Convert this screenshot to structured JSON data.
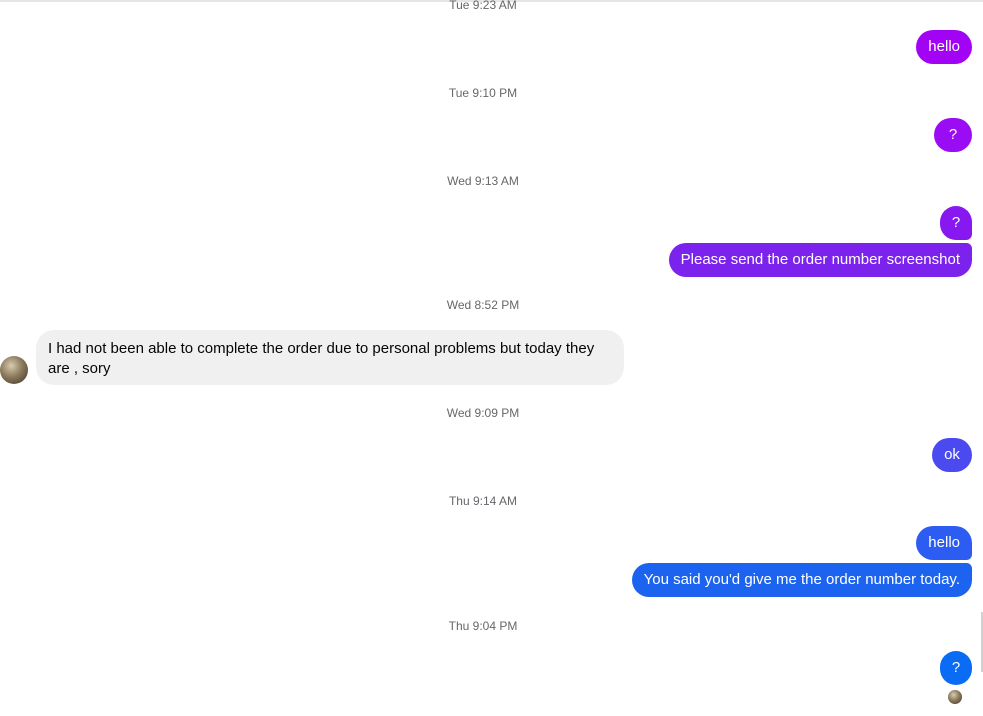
{
  "timestamps": [
    "Tue 9:23 AM",
    "Tue 9:10 PM",
    "Wed 9:13 AM",
    "Wed 8:52 PM",
    "Wed 9:09 PM",
    "Thu 9:14 AM",
    "Thu 9:04 PM"
  ],
  "messages": [
    {
      "dir": "out",
      "text": "hello",
      "color": "#a203f5"
    },
    {
      "dir": "out",
      "text": "?",
      "color": "#9a0cf3"
    },
    {
      "dir": "out",
      "text": "?",
      "color": "#8718f0"
    },
    {
      "dir": "out",
      "text": "Please send the order number screenshot",
      "color": "#7b22ec"
    },
    {
      "dir": "in",
      "text": "I had not been able to complete the order due to personal problems but today they are , sory",
      "color": "#f0f0f0"
    },
    {
      "dir": "out",
      "text": "ok",
      "color": "#4a4af0"
    },
    {
      "dir": "out",
      "text": "hello",
      "color": "#2c5cf2"
    },
    {
      "dir": "out",
      "text": "You said you'd give me the order number today.",
      "color": "#1c63f0"
    },
    {
      "dir": "out",
      "text": "?",
      "color": "#0a6cf5"
    }
  ]
}
